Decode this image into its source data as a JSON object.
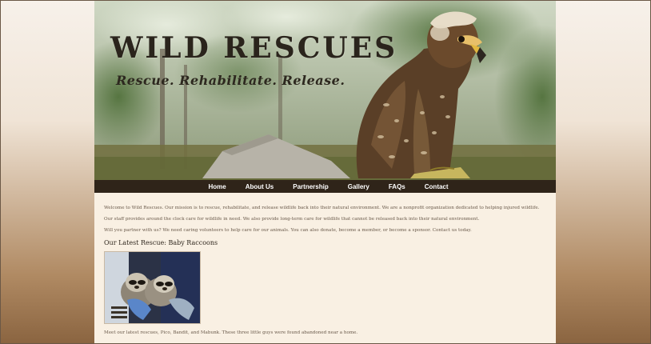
{
  "site": {
    "title": "WILD RESCUES",
    "tagline": "Rescue. Rehabilitate. Release."
  },
  "nav": {
    "items": [
      {
        "label": "Home"
      },
      {
        "label": "About Us"
      },
      {
        "label": "Partnership"
      },
      {
        "label": "Gallery"
      },
      {
        "label": "FAQs"
      },
      {
        "label": "Contact"
      }
    ]
  },
  "content": {
    "paragraphs": [
      "Welcome to Wild Rescues. Our mission is to rescue, rehabilitate, and release wildlife back into their natural environment. We are a nonprofit organization dedicated to helping injured wildlife.",
      "Our staff provides around the clock care for wildlife in need. We also provide long-term care for wildlife that cannot be released back into their natural environment.",
      "Will you partner with us? We need caring volunteers to help care for our animals. You can also donate, become a member, or become a sponsor. Contact us today."
    ],
    "latest_heading": "Our Latest Rescue: Baby Raccoons",
    "caption": "Meet our latest rescues, Pico, Bandit, and Mabunk. These three little guys were found abandoned near a home."
  },
  "colors": {
    "nav_bg": "#2f2419",
    "page_bg": "#f9f0e3",
    "title_color": "#2a241c"
  },
  "icons": {
    "banner_image": "hawk-photo",
    "rescue_image": "raccoons-photo"
  }
}
